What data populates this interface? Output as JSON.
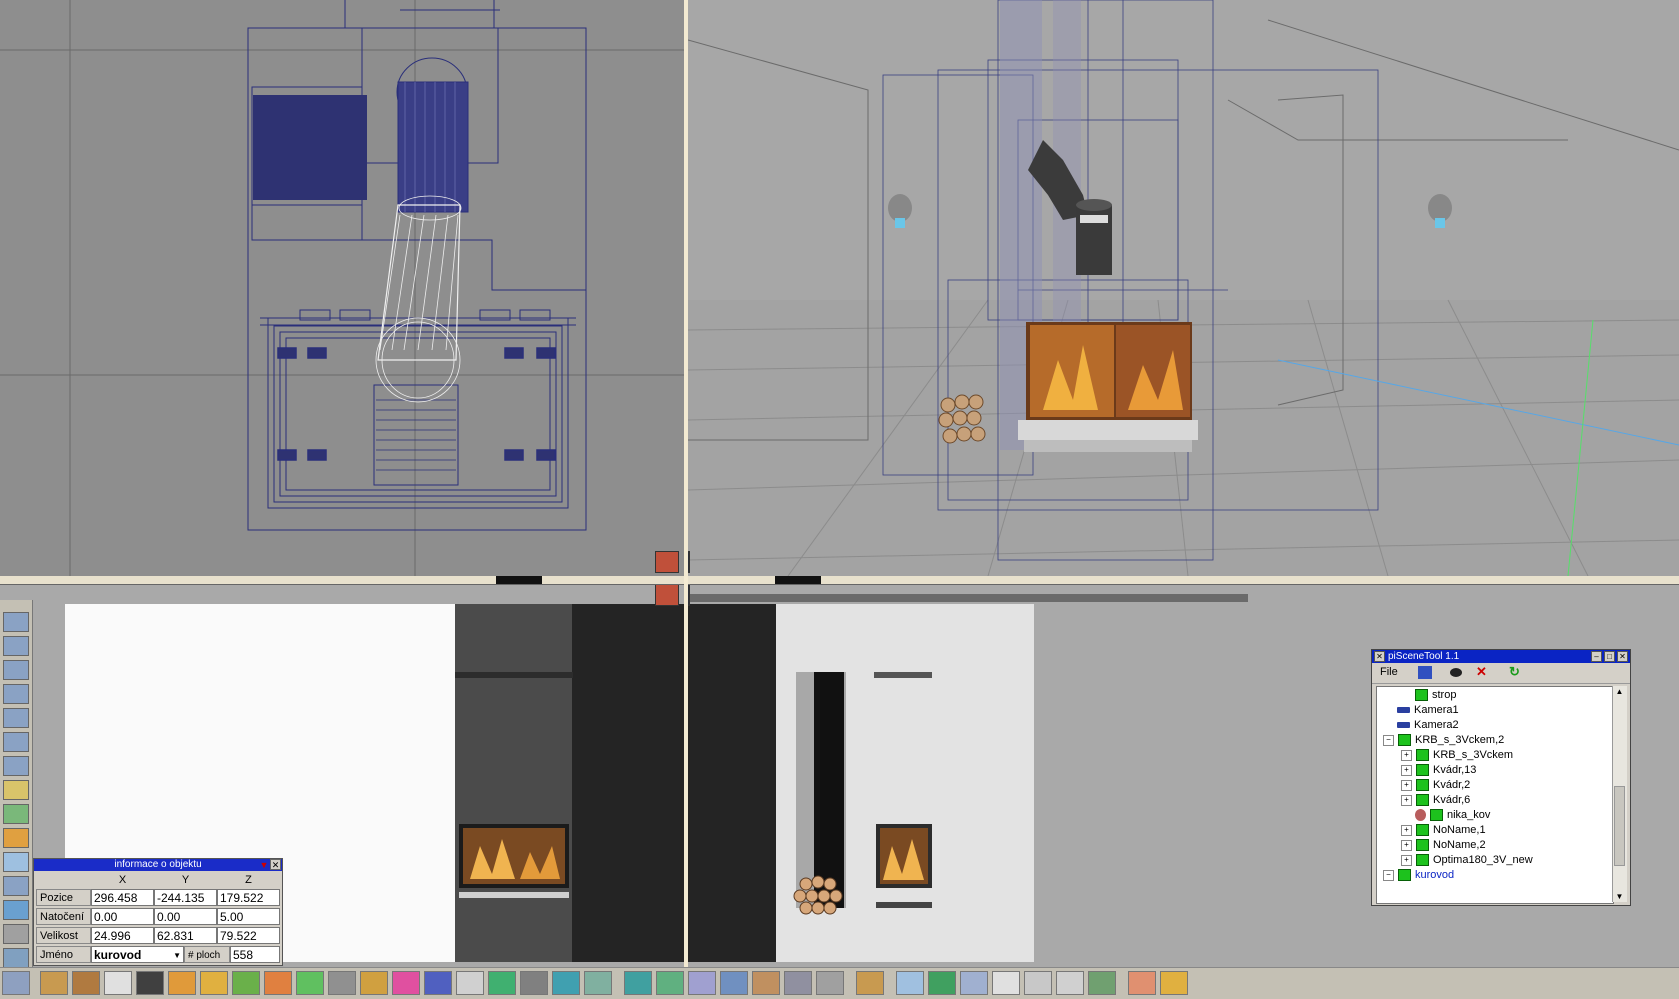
{
  "viewport_buttons": {
    "top_right_1": "render-button",
    "top_right_2": "camera-button",
    "bottom_1": "house-button",
    "bottom_2": "house-dark-button"
  },
  "info_panel": {
    "title": "informace o objektu",
    "columns": [
      "X",
      "Y",
      "Z"
    ],
    "rows": [
      {
        "label": "Pozice",
        "values": [
          "296.458",
          "-244.135",
          "179.522"
        ]
      },
      {
        "label": "Natočení",
        "values": [
          "0.00",
          "0.00",
          "5.00"
        ]
      },
      {
        "label": "Velikost",
        "values": [
          "24.996",
          "62.831",
          "79.522"
        ]
      }
    ],
    "name_label": "Jméno",
    "name_value": "kurovod",
    "faces_label": "# ploch",
    "faces_value": "558"
  },
  "scene_tool": {
    "title": "piSceneTool 1.1",
    "menu_file": "File",
    "tree": [
      {
        "label": "strop",
        "icon": "green-box-icon"
      },
      {
        "label": "Kamera1",
        "icon": "camera-icon"
      },
      {
        "label": "Kamera2",
        "icon": "camera-icon"
      },
      {
        "label": "KRB_s_3Vckem,2",
        "icon": "group-icon"
      },
      {
        "label": "KRB_s_3Vckem",
        "icon": "group-icon"
      },
      {
        "label": "Kvádr,13",
        "icon": "green-box-icon"
      },
      {
        "label": "Kvádr,2",
        "icon": "green-box-icon"
      },
      {
        "label": "Kvádr,6",
        "icon": "green-box-icon"
      },
      {
        "label": "nika_kov",
        "icon": "eye-icon"
      },
      {
        "label": "NoName,1",
        "icon": "group-icon"
      },
      {
        "label": "NoName,2",
        "icon": "group-icon"
      },
      {
        "label": "Optima180_3V_new",
        "icon": "group-icon"
      },
      {
        "label": "kurovod",
        "icon": "group-icon"
      }
    ]
  },
  "colors": {
    "wire": "#2a2f7a",
    "titlebar": "#0a24c4",
    "panel": "#d4d0c8"
  }
}
